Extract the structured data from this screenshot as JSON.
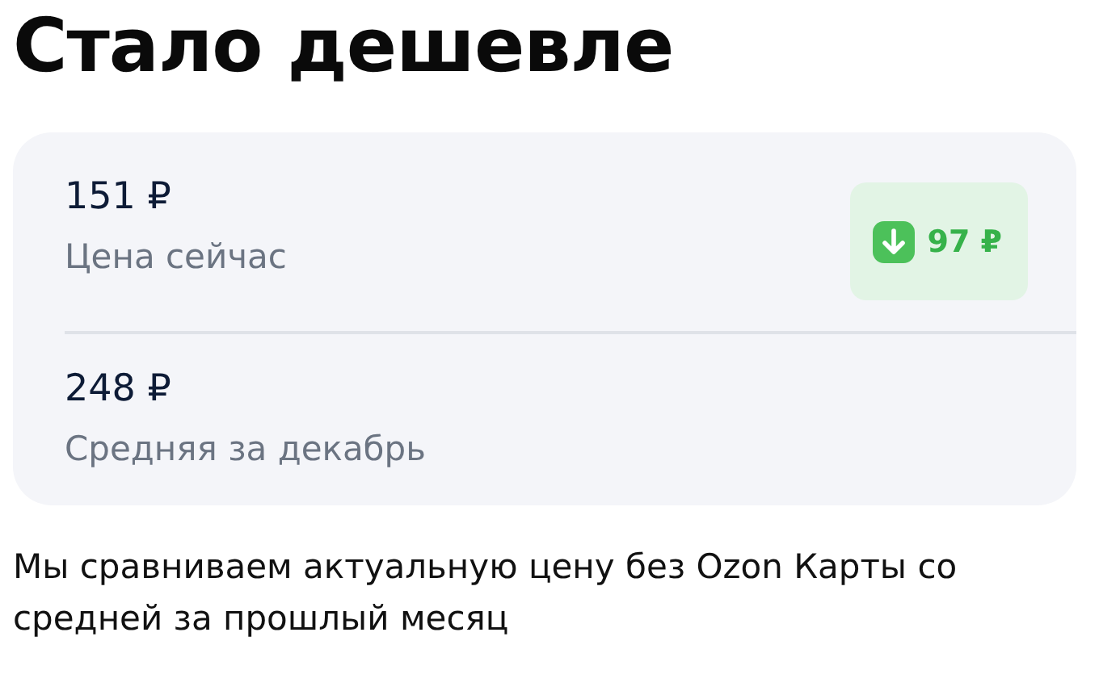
{
  "title": "Стало дешевле",
  "card": {
    "rows": [
      {
        "price": "151 ₽",
        "label": "Цена сейчас",
        "badge": {
          "kind": "down",
          "text": "97 ₽"
        }
      },
      {
        "price": "248 ₽",
        "label": "Средняя за декабрь"
      }
    ]
  },
  "note": "Мы сравниваем актуальную цену без Ozon Карты со средней за прошлый месяц"
}
